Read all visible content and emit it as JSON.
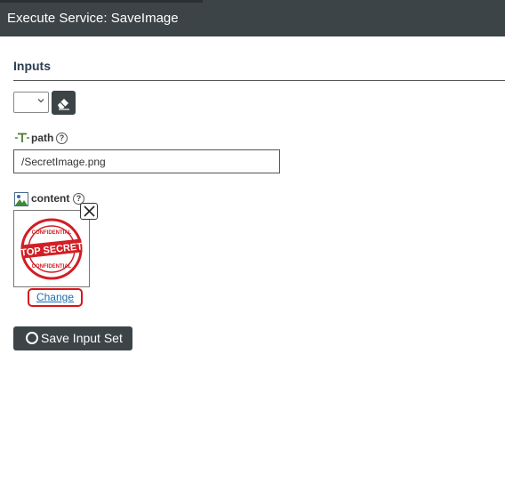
{
  "window": {
    "title": "Execute Service: SaveImage"
  },
  "inputs_section": {
    "title": "Inputs"
  },
  "input_set": {
    "selected": ""
  },
  "fields": {
    "path": {
      "label": "path",
      "value": "/SecretImage.png",
      "type_icon": "text-type-icon"
    },
    "content": {
      "label": "content",
      "type_icon": "image-type-icon",
      "image": {
        "stamp_top": "CONFIDENTIAL",
        "stamp_main": "TOP SECRET",
        "stamp_bottom": "CONFIDENTIAL"
      },
      "change_label": "Change"
    }
  },
  "help_glyph": "?",
  "save_button": {
    "label": "Save Input Set"
  },
  "colors": {
    "dark": "#3c4447",
    "highlight": "#d8141c",
    "link": "#1a6fb0",
    "stamp": "#d11f26"
  }
}
